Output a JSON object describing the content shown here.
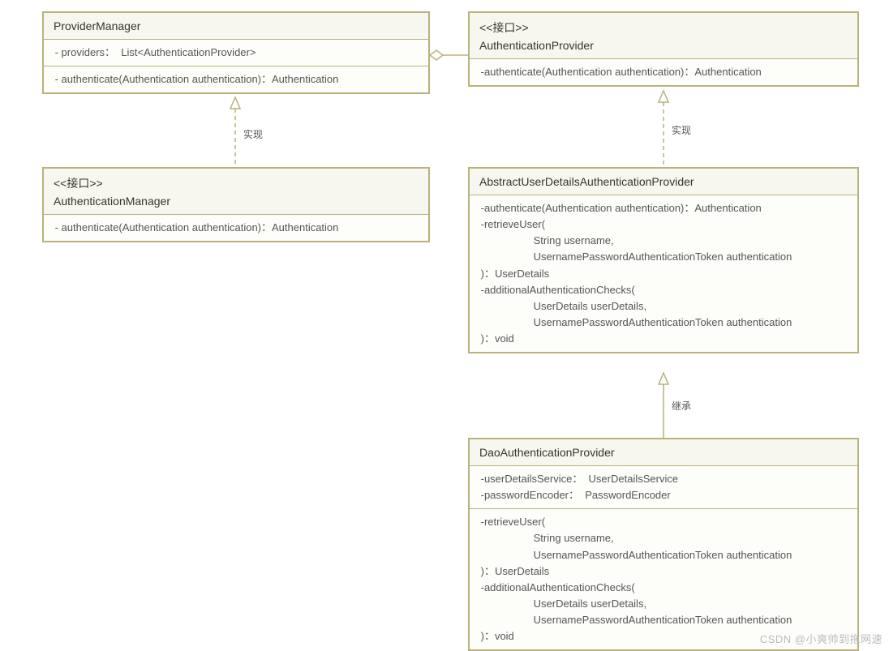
{
  "boxes": {
    "pm": {
      "title": "ProviderManager",
      "attrs": " - providers：  List<AuthenticationProvider>",
      "ops": " - authenticate(Authentication authentication)：Authentication"
    },
    "am": {
      "stereo": "<<接口>>",
      "title": "AuthenticationManager",
      "ops": " - authenticate(Authentication authentication)：Authentication"
    },
    "ap": {
      "stereo": "<<接口>>",
      "title": "AuthenticationProvider",
      "ops": " -authenticate(Authentication authentication)：Authentication"
    },
    "abstract": {
      "title": "AbstractUserDetailsAuthenticationProvider",
      "ops": " -authenticate(Authentication authentication)：Authentication\n -retrieveUser(\n                   String username,\n                   UsernamePasswordAuthenticationToken authentication\n )：UserDetails\n -additionalAuthenticationChecks(\n                   UserDetails userDetails,\n                   UsernamePasswordAuthenticationToken authentication\n )：void"
    },
    "dao": {
      "title": "DaoAuthenticationProvider",
      "attrs": " -userDetailsService：  UserDetailsService\n -passwordEncoder：  PasswordEncoder",
      "ops": " -retrieveUser(\n                   String username,\n                   UsernamePasswordAuthenticationToken authentication\n )：UserDetails\n -additionalAuthenticationChecks(\n                   UserDetails userDetails,\n                   UsernamePasswordAuthenticationToken authentication\n )：void"
    }
  },
  "labels": {
    "pm_am": "实现",
    "ap_abstract": "实现",
    "abstract_dao": "继承"
  },
  "watermark": "CSDN @小爽帅到拖网速"
}
